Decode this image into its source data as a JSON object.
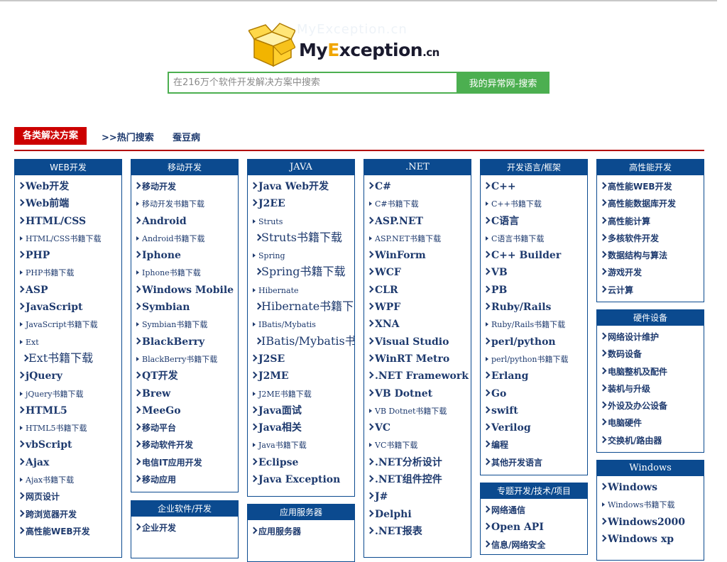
{
  "logo": {
    "brand_my": "My",
    "brand_e": "E",
    "brand_rest": "xception",
    "brand_tld": ".cn",
    "ghost_text": "MyException.cn"
  },
  "search": {
    "placeholder": "在216万个软件开发解决方案中搜索",
    "button": "我的异常网-搜索"
  },
  "tabs": {
    "active": "各类解决方案",
    "hot": ">>热门搜索",
    "silkworm": "蚕豆病"
  },
  "colors": {
    "accent_red": "#cc0000",
    "header_blue": "#0b4a8f",
    "search_green": "#4caf50",
    "link": "#1e3a6e",
    "logo_gold": "#f0a500"
  },
  "icons": {
    "logo": "gold-box-icon",
    "bullet": "chevron-right-icon",
    "small_bullet": "triangle-right-icon"
  },
  "boxes": {
    "web": {
      "title": "WEB开发",
      "items": [
        {
          "t": "Web开发",
          "k": "b"
        },
        {
          "t": "Web前端",
          "k": "b"
        },
        {
          "t": "HTML/CSS",
          "k": "b"
        },
        {
          "t": "HTML/CSS书籍下载",
          "k": "s"
        },
        {
          "t": "PHP",
          "k": "b"
        },
        {
          "t": "PHP书籍下载",
          "k": "s"
        },
        {
          "t": "ASP",
          "k": "b"
        },
        {
          "t": "JavaScript",
          "k": "b"
        },
        {
          "t": "JavaScript书籍下载",
          "k": "s"
        },
        {
          "t": "Ext",
          "k": "s"
        },
        {
          "t": "Ext书籍下载",
          "k": "ss"
        },
        {
          "t": "jQuery",
          "k": "b"
        },
        {
          "t": "jQuery书籍下载",
          "k": "s"
        },
        {
          "t": "HTML5",
          "k": "b"
        },
        {
          "t": "HTML5书籍下载",
          "k": "s"
        },
        {
          "t": "vbScript",
          "k": "b"
        },
        {
          "t": "Ajax",
          "k": "b"
        },
        {
          "t": "Ajax书籍下载",
          "k": "s"
        },
        {
          "t": "网页设计",
          "k": "m"
        },
        {
          "t": "跨浏览器开发",
          "k": "m"
        },
        {
          "t": "高性能WEB开发",
          "k": "m"
        }
      ]
    },
    "mobile": {
      "title": "移动开发",
      "items": [
        {
          "t": "移动开发",
          "k": "m"
        },
        {
          "t": "移动开发书籍下载",
          "k": "s"
        },
        {
          "t": "Android",
          "k": "b"
        },
        {
          "t": "Android书籍下载",
          "k": "s"
        },
        {
          "t": "Iphone",
          "k": "b"
        },
        {
          "t": "Iphone书籍下载",
          "k": "s"
        },
        {
          "t": "Windows Mobile",
          "k": "b"
        },
        {
          "t": "Symbian",
          "k": "b"
        },
        {
          "t": "Symbian书籍下载",
          "k": "s"
        },
        {
          "t": "BlackBerry",
          "k": "b"
        },
        {
          "t": "BlackBerry书籍下载",
          "k": "s"
        },
        {
          "t": "QT开发",
          "k": "b"
        },
        {
          "t": "Brew",
          "k": "b"
        },
        {
          "t": "MeeGo",
          "k": "b"
        },
        {
          "t": "移动平台",
          "k": "m"
        },
        {
          "t": "移动软件开发",
          "k": "m"
        },
        {
          "t": "电信IT应用开发",
          "k": "m"
        },
        {
          "t": "移动应用",
          "k": "m"
        }
      ]
    },
    "enterprise": {
      "title": "企业软件/开发",
      "items": [
        {
          "t": "企业开发",
          "k": "m"
        }
      ]
    },
    "java": {
      "title": "JAVA",
      "items": [
        {
          "t": "Java Web开发",
          "k": "b"
        },
        {
          "t": "J2EE",
          "k": "b"
        },
        {
          "t": "Struts",
          "k": "s"
        },
        {
          "t": "Struts书籍下载",
          "k": "ss"
        },
        {
          "t": "Spring",
          "k": "s"
        },
        {
          "t": "Spring书籍下载",
          "k": "ss"
        },
        {
          "t": "Hibernate",
          "k": "s"
        },
        {
          "t": "Hibernate书籍下载",
          "k": "ss"
        },
        {
          "t": "IBatis/Mybatis",
          "k": "s"
        },
        {
          "t": "IBatis/Mybatis书籍下载",
          "k": "ss"
        },
        {
          "t": "J2SE",
          "k": "b"
        },
        {
          "t": "J2ME",
          "k": "b"
        },
        {
          "t": "J2ME书籍下载",
          "k": "s"
        },
        {
          "t": "Java面试",
          "k": "b"
        },
        {
          "t": "Java相关",
          "k": "b"
        },
        {
          "t": "Java书籍下载",
          "k": "s"
        },
        {
          "t": "Eclipse",
          "k": "b"
        },
        {
          "t": "Java Exception",
          "k": "b"
        }
      ]
    },
    "appserver": {
      "title": "应用服务器",
      "items": [
        {
          "t": "应用服务器",
          "k": "m"
        }
      ]
    },
    "dotnet": {
      "title": ".NET",
      "items": [
        {
          "t": "C#",
          "k": "b"
        },
        {
          "t": "C#书籍下载",
          "k": "s"
        },
        {
          "t": "ASP.NET",
          "k": "b"
        },
        {
          "t": "ASP.NET书籍下载",
          "k": "s"
        },
        {
          "t": "WinForm",
          "k": "b"
        },
        {
          "t": "WCF",
          "k": "b"
        },
        {
          "t": "CLR",
          "k": "b"
        },
        {
          "t": "WPF",
          "k": "b"
        },
        {
          "t": "XNA",
          "k": "b"
        },
        {
          "t": "Visual Studio",
          "k": "b"
        },
        {
          "t": "WinRT Metro",
          "k": "b"
        },
        {
          "t": ".NET Framework",
          "k": "b"
        },
        {
          "t": "VB Dotnet",
          "k": "b"
        },
        {
          "t": "VB Dotnet书籍下载",
          "k": "s"
        },
        {
          "t": "VC",
          "k": "b"
        },
        {
          "t": "VC书籍下载",
          "k": "s"
        },
        {
          "t": ".NET分析设计",
          "k": "b"
        },
        {
          "t": ".NET组件控件",
          "k": "b"
        },
        {
          "t": "J#",
          "k": "b"
        },
        {
          "t": "Delphi",
          "k": "b"
        },
        {
          "t": ".NET报表",
          "k": "b"
        }
      ]
    },
    "languages": {
      "title": "开发语言/框架",
      "items": [
        {
          "t": "C++",
          "k": "b"
        },
        {
          "t": "C++书籍下载",
          "k": "s"
        },
        {
          "t": "C语言",
          "k": "b"
        },
        {
          "t": "C语言书籍下载",
          "k": "s"
        },
        {
          "t": "C++ Builder",
          "k": "b"
        },
        {
          "t": "VB",
          "k": "b"
        },
        {
          "t": "PB",
          "k": "b"
        },
        {
          "t": "Ruby/Rails",
          "k": "b"
        },
        {
          "t": "Ruby/Rails书籍下载",
          "k": "s"
        },
        {
          "t": "perl/python",
          "k": "b"
        },
        {
          "t": "perl/python书籍下载",
          "k": "s"
        },
        {
          "t": "Erlang",
          "k": "b"
        },
        {
          "t": "Go",
          "k": "b"
        },
        {
          "t": "swift",
          "k": "b"
        },
        {
          "t": "Verilog",
          "k": "b"
        },
        {
          "t": "编程",
          "k": "m"
        },
        {
          "t": "其他开发语言",
          "k": "m"
        }
      ]
    },
    "projects": {
      "title": "专题开发/技术/项目",
      "items": [
        {
          "t": "网络通信",
          "k": "m"
        },
        {
          "t": "Open API",
          "k": "b"
        },
        {
          "t": "信息/网络安全",
          "k": "m"
        }
      ]
    },
    "hpc": {
      "title": "高性能开发",
      "items": [
        {
          "t": "高性能WEB开发",
          "k": "m"
        },
        {
          "t": "高性能数据库开发",
          "k": "m"
        },
        {
          "t": "高性能计算",
          "k": "m"
        },
        {
          "t": "多核软件开发",
          "k": "m"
        },
        {
          "t": "数据结构与算法",
          "k": "m"
        },
        {
          "t": "游戏开发",
          "k": "m"
        },
        {
          "t": "云计算",
          "k": "m"
        }
      ]
    },
    "hardware": {
      "title": "硬件设备",
      "items": [
        {
          "t": "网络设计维护",
          "k": "m"
        },
        {
          "t": "数码设备",
          "k": "m"
        },
        {
          "t": "电脑整机及配件",
          "k": "m"
        },
        {
          "t": "装机与升级",
          "k": "m"
        },
        {
          "t": "外设及办公设备",
          "k": "m"
        },
        {
          "t": "电脑硬件",
          "k": "m"
        },
        {
          "t": "交换机/路由器",
          "k": "m"
        }
      ]
    },
    "windows": {
      "title": "Windows",
      "items": [
        {
          "t": "Windows",
          "k": "b"
        },
        {
          "t": "Windows书籍下载",
          "k": "s"
        },
        {
          "t": "Windows2000",
          "k": "b"
        },
        {
          "t": "Windows xp",
          "k": "b"
        }
      ]
    }
  }
}
